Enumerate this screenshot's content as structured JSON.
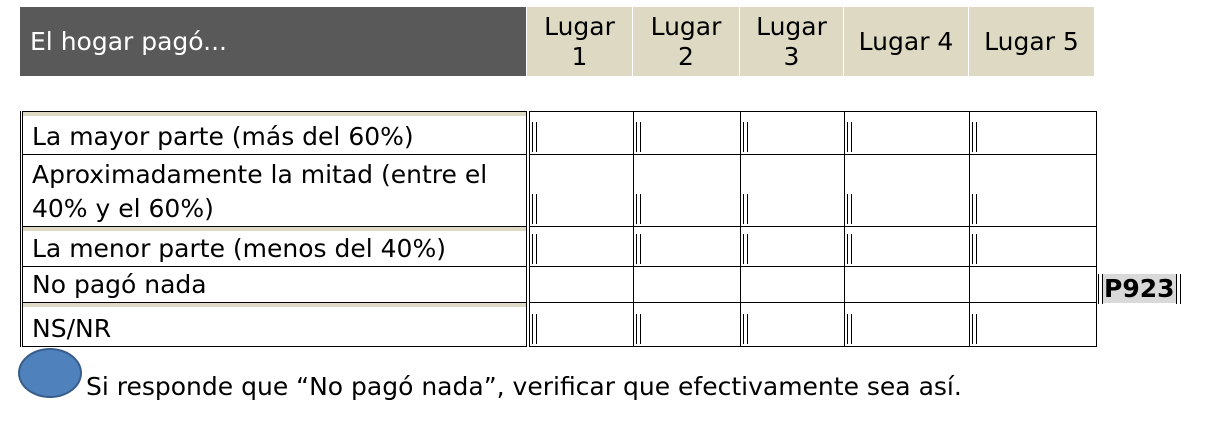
{
  "header": {
    "title": "El hogar pagó...",
    "columns": [
      {
        "line1": "Lugar",
        "line2": "1"
      },
      {
        "line1": "Lugar",
        "line2": "2"
      },
      {
        "line1": "Lugar",
        "line2": "3"
      },
      {
        "line1": "Lugar 4",
        "line2": ""
      },
      {
        "line1": "Lugar 5",
        "line2": ""
      }
    ]
  },
  "rows": [
    {
      "line1": "La mayor parte (más del 60%)",
      "line2": ""
    },
    {
      "line1": "Aproximadamente la mitad (entre el",
      "line2": "40% y el 60%)"
    },
    {
      "line1": "La menor parte (menos del 40%)",
      "line2": ""
    },
    {
      "line1": "No pagó nada",
      "line2": ""
    },
    {
      "line1": "NS/NR",
      "line2": ""
    }
  ],
  "skip_code": "P923",
  "note": "Si responde que “No pagó nada”, verificar que efectivamente sea así.",
  "colors": {
    "header_dark": "#595959",
    "header_light": "#ddd9c3",
    "dot": "#4f81bd"
  }
}
